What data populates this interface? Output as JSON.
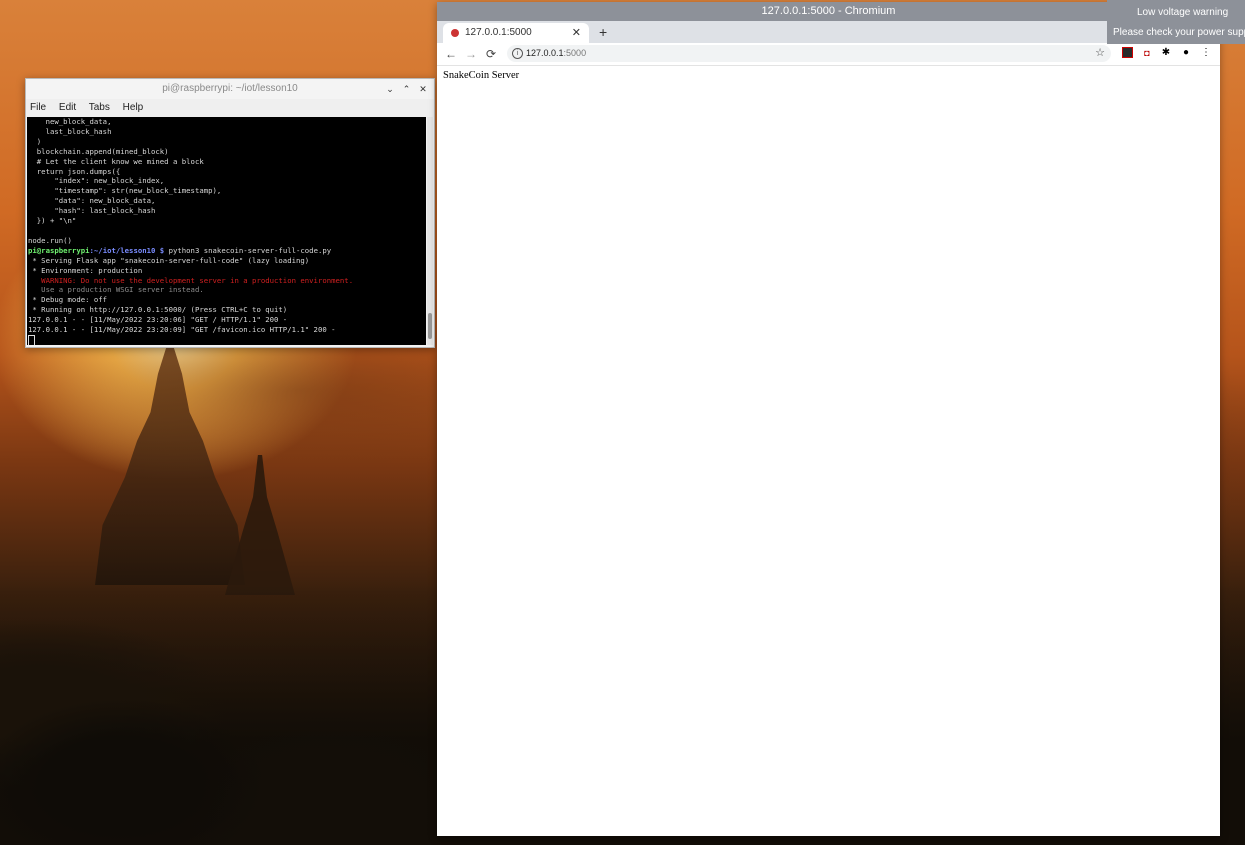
{
  "terminal": {
    "title": "pi@raspberrypi: ~/iot/lesson10",
    "controls": [
      "⌄",
      "⌃",
      "✕"
    ],
    "menu": [
      "File",
      "Edit",
      "Tabs",
      "Help"
    ],
    "lines": [
      {
        "text": "    new_block_data,",
        "style": ""
      },
      {
        "text": "    last_block_hash",
        "style": ""
      },
      {
        "text": "  )",
        "style": ""
      },
      {
        "text": "  blockchain.append(mined_block)",
        "style": ""
      },
      {
        "text": "  # Let the client know we mined a block",
        "style": ""
      },
      {
        "text": "  return json.dumps({",
        "style": ""
      },
      {
        "text": "      \"index\": new_block_index,",
        "style": ""
      },
      {
        "text": "      \"timestamp\": str(new_block_timestamp),",
        "style": ""
      },
      {
        "text": "      \"data\": new_block_data,",
        "style": ""
      },
      {
        "text": "      \"hash\": last_block_hash",
        "style": ""
      },
      {
        "text": "  }) + \"\\n\"",
        "style": ""
      },
      {
        "text": "",
        "style": ""
      },
      {
        "text": "node.run()",
        "style": ""
      },
      {
        "text": " * Serving Flask app \"snakecoin-server-full-code\" (lazy loading)",
        "style": ""
      },
      {
        "text": " * Environment: production",
        "style": ""
      },
      {
        "text": "   WARNING: Do not use the development server in a production environment.",
        "style": "warn"
      },
      {
        "text": "   Use a production WSGI server instead.",
        "style": "dim"
      },
      {
        "text": " * Debug mode: off",
        "style": ""
      },
      {
        "text": " * Running on http://127.0.0.1:5000/ (Press CTRL+C to quit)",
        "style": ""
      },
      {
        "text": "127.0.0.1 - - [11/May/2022 23:20:06] \"GET / HTTP/1.1\" 200 -",
        "style": ""
      },
      {
        "text": "127.0.0.1 - - [11/May/2022 23:20:09] \"GET /favicon.ico HTTP/1.1\" 200 -",
        "style": ""
      }
    ],
    "prompt": {
      "user": "pi@raspberrypi",
      "path": ":~/iot/lesson10 $",
      "command": " python3 snakecoin-server-full-code.py"
    }
  },
  "browser": {
    "window_title": "127.0.0.1:5000 - Chromium",
    "tab_label": "127.0.0.1:5000",
    "tab_close": "✕",
    "new_tab": "+",
    "nav": {
      "back": "←",
      "forward": "→",
      "reload": "⟳"
    },
    "url_host": "127.0.0.1",
    "url_port": ":5000",
    "star": "☆",
    "page_text": "SnakeCoin Server"
  },
  "notification": {
    "title": "Low voltage warning",
    "body": "Please check your power supp"
  },
  "icons": {
    "pagoda": "pagoda-silhouette",
    "favicon": "red-dot-icon"
  }
}
